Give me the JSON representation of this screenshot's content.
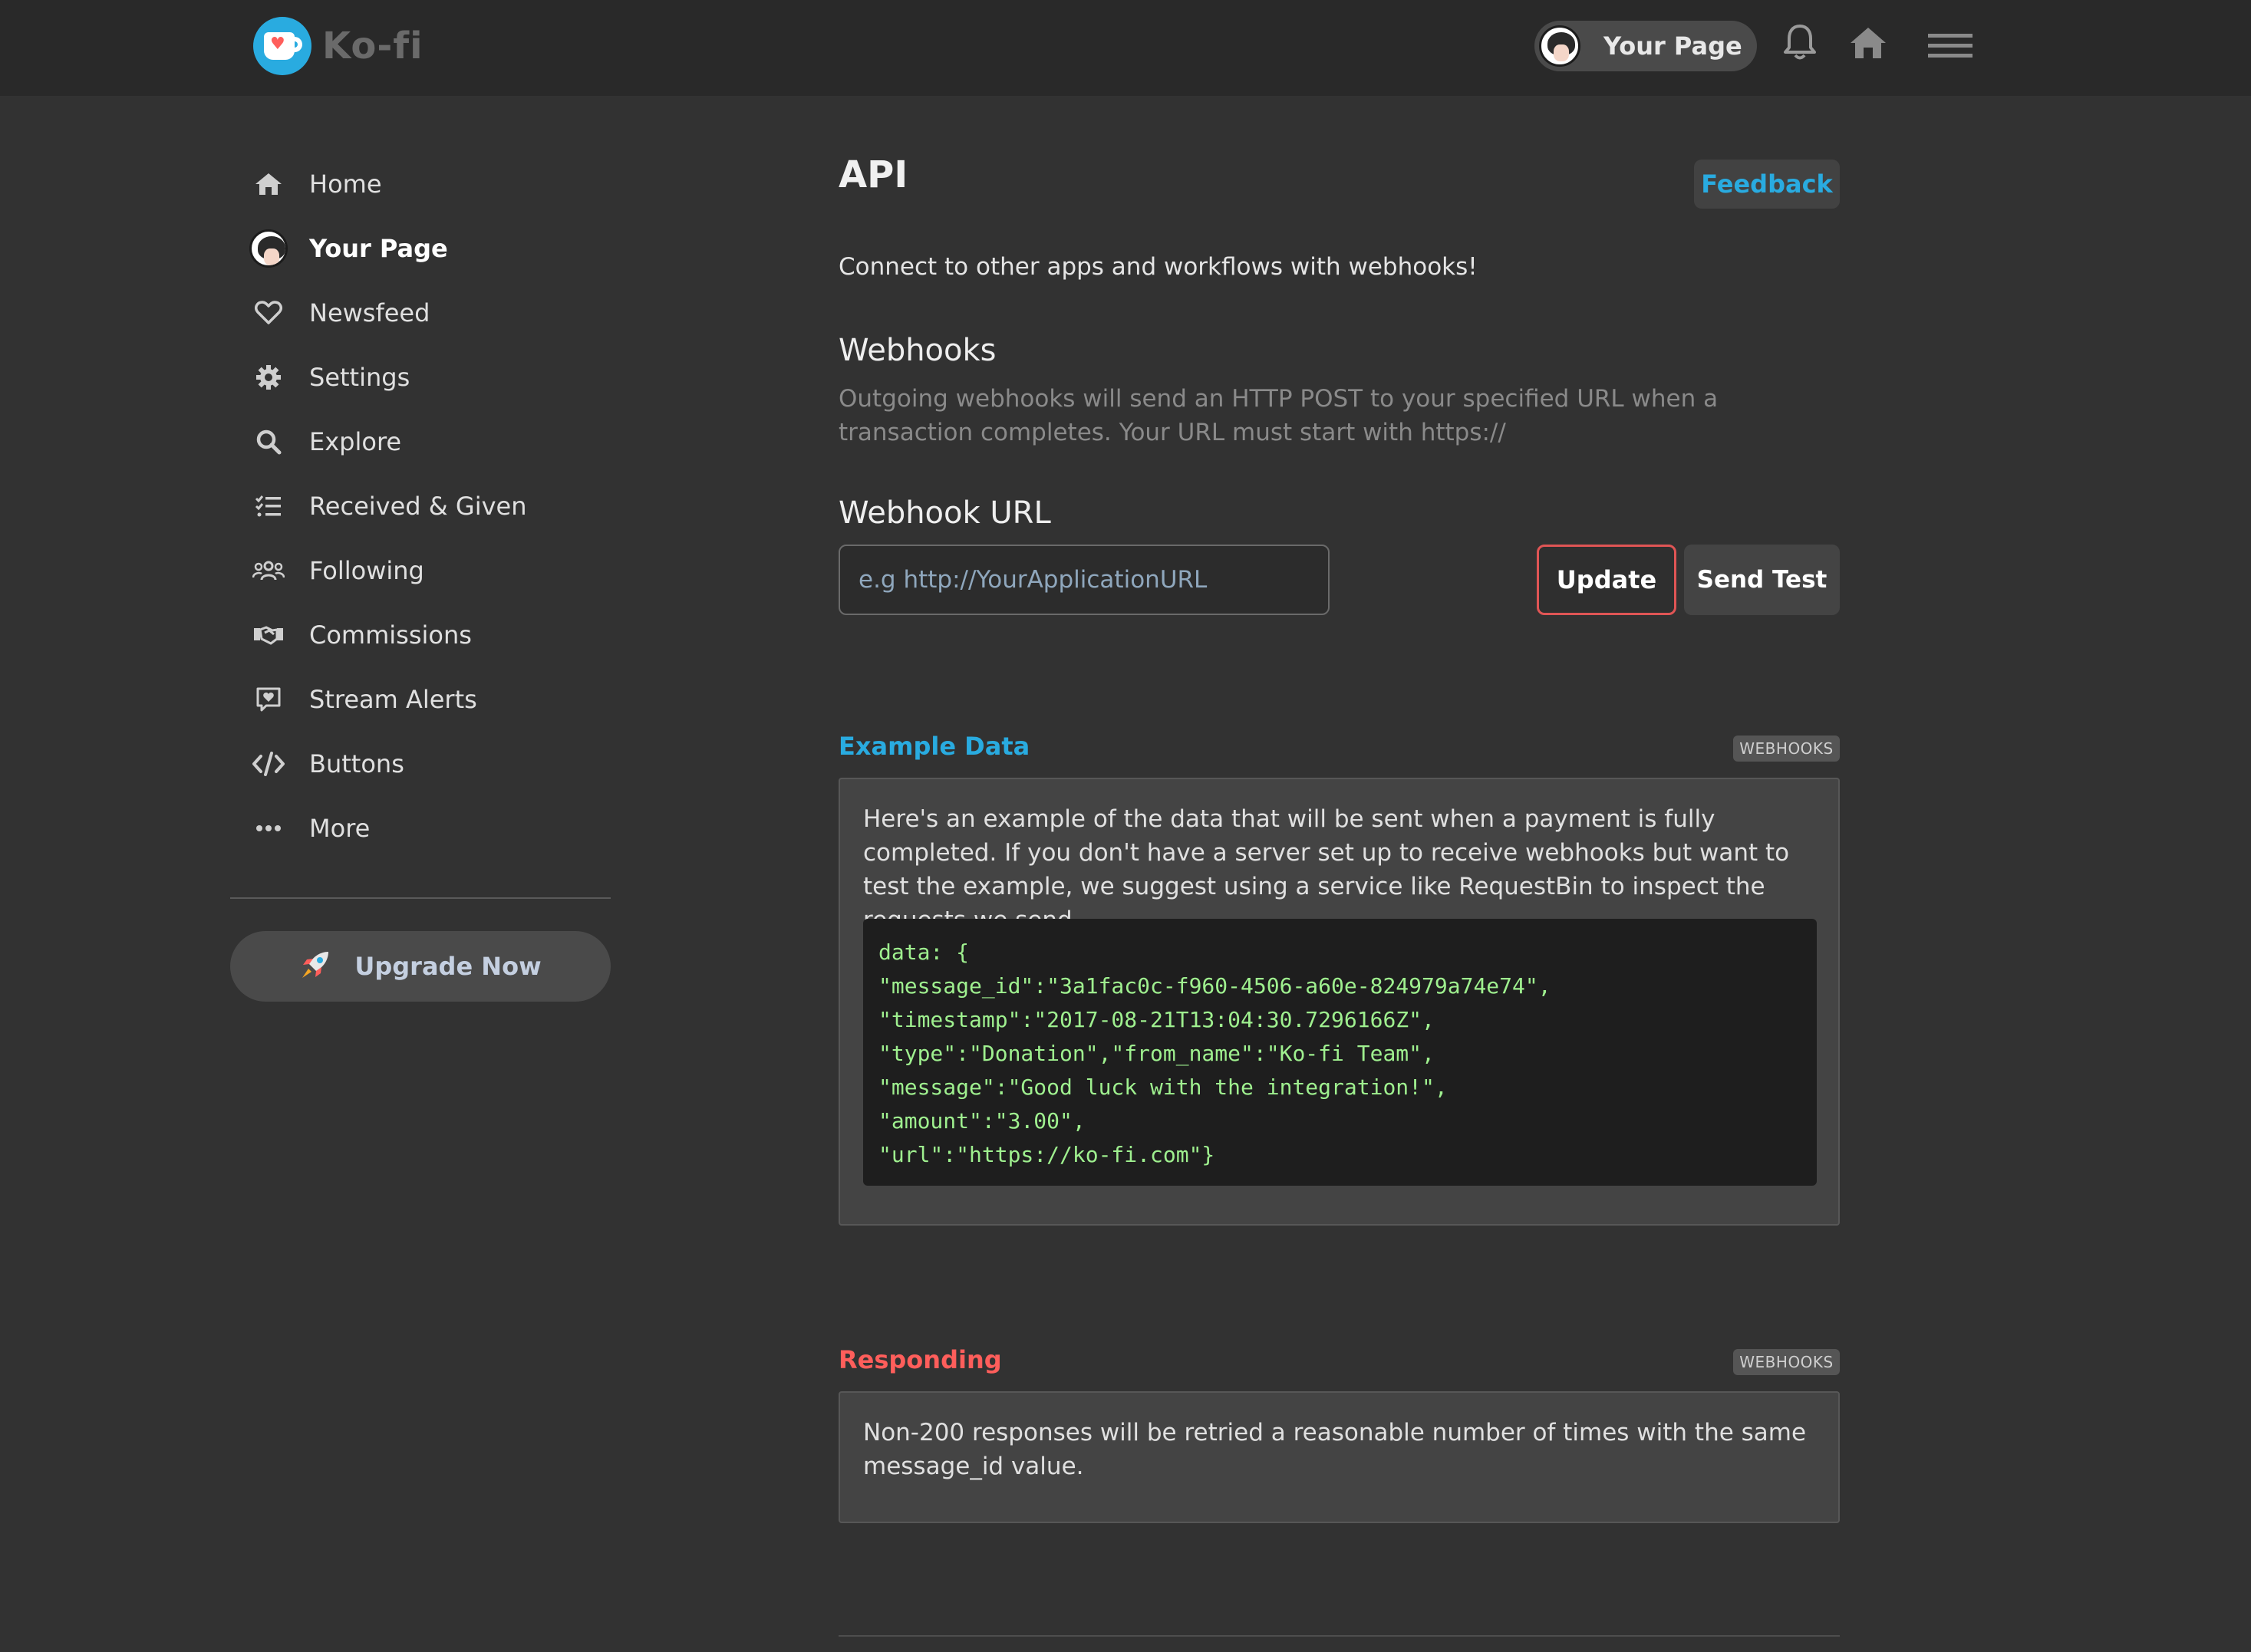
{
  "header": {
    "logo_text": "Ko-fi",
    "your_page_label": "Your Page"
  },
  "sidebar": {
    "items": [
      {
        "label": "Home",
        "icon": "home-icon"
      },
      {
        "label": "Your Page",
        "icon": "avatar"
      },
      {
        "label": "Newsfeed",
        "icon": "heart-icon"
      },
      {
        "label": "Settings",
        "icon": "gear-icon"
      },
      {
        "label": "Explore",
        "icon": "search-icon"
      },
      {
        "label": "Received & Given",
        "icon": "list-check-icon"
      },
      {
        "label": "Following",
        "icon": "users-icon"
      },
      {
        "label": "Commissions",
        "icon": "handshake-icon"
      },
      {
        "label": "Stream Alerts",
        "icon": "alert-message-icon"
      },
      {
        "label": "Buttons",
        "icon": "code-icon"
      },
      {
        "label": "More",
        "icon": "ellipsis-icon"
      }
    ],
    "upgrade_label": "Upgrade Now"
  },
  "main": {
    "title": "API",
    "feedback_label": "Feedback",
    "intro": "Connect to other apps and workflows with webhooks!",
    "webhooks_heading": "Webhooks",
    "webhooks_description": "Outgoing webhooks will send an HTTP POST to your specified URL when a transaction completes. Your URL must start with https://",
    "webhook_url_heading": "Webhook URL",
    "webhook_url_placeholder": "e.g http://YourApplicationURL",
    "webhook_url_value": "",
    "update_label": "Update",
    "send_test_label": "Send Test",
    "example": {
      "title": "Example Data",
      "badge": "WEBHOOKS",
      "text": "Here's an example of the data that will be sent when a payment is fully completed. If you don't have a server set up to receive webhooks but want to test the example, we suggest using a service like RequestBin to inspect the requests we send.",
      "code_lines": [
        "data: {",
        "\"message_id\":\"3a1fac0c-f960-4506-a60e-824979a74e74\",",
        "\"timestamp\":\"2017-08-21T13:04:30.7296166Z\",",
        "\"type\":\"Donation\",\"from_name\":\"Ko-fi Team\",",
        "\"message\":\"Good luck with the integration!\",",
        "\"amount\":\"3.00\",",
        "\"url\":\"https://ko-fi.com\"}"
      ]
    },
    "responding": {
      "title": "Responding",
      "badge": "WEBHOOKS",
      "text": "Non-200 responses will be retried a reasonable number of times with the same message_id value."
    }
  },
  "colors": {
    "accent_blue": "#29abe0",
    "accent_red": "#ff5e5b",
    "code_green": "#9ff08f"
  }
}
